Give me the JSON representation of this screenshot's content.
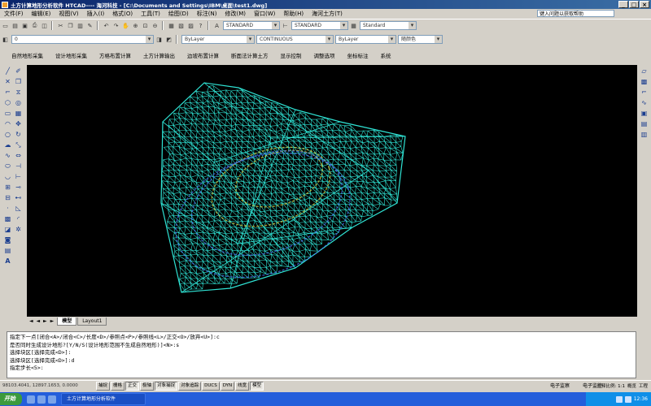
{
  "window": {
    "title": "土方计算地形分析软件 HTCAD---- 海河科技 - [C:\\Documents and Settings\\IBM\\桌面\\test1.dwg]"
  },
  "menu": [
    "文件(F)",
    "编辑(E)",
    "视图(V)",
    "插入(I)",
    "格式(O)",
    "工具(T)",
    "绘图(D)",
    "标注(N)",
    "修改(M)",
    "窗口(W)",
    "帮助(H)",
    "海河土方(T)"
  ],
  "help_search": {
    "placeholder": "键入问题以获取帮助"
  },
  "toolbar": {
    "text_style": "STANDARD",
    "dim_style": "STANDARD",
    "table_style": "Standard",
    "layer": "0",
    "color": "ByLayer",
    "linetype": "CONTINUOUS",
    "lineweight": "ByLayer",
    "plot_style": "随颜色"
  },
  "custom_menu": [
    "自然地形采集",
    "设计地形采集",
    "方格布置计算",
    "土方计算输出",
    "边坡布置计算",
    "断面法计算土方",
    "显示控制",
    "调整选项",
    "坐标标注",
    "系统"
  ],
  "layout_tabs": {
    "nav": "◄ ◄ ► ►",
    "tabs": [
      "模型",
      "Layout1"
    ],
    "active": 0
  },
  "command_lines": [
    "指定下一点[闭合<A>/闭合<C>/长度<D>/参照点<P>/参照线<L>/正交<O>/放弃<U>]:c",
    "是否同时生成设计地形?[Y/N/S(设计地形范围不生成自然地形)]<N>:s",
    "选择块区[选择完成<D>]:",
    "选择块区[选择完成<D>]:d",
    "指定步长<5>:"
  ],
  "status": {
    "coords": "98103.4041, 12897.1653, 0.0000",
    "toggles": [
      {
        "label": "捕捉",
        "on": false
      },
      {
        "label": "栅格",
        "on": false
      },
      {
        "label": "正交",
        "on": true
      },
      {
        "label": "极轴",
        "on": false
      },
      {
        "label": "对象捕捉",
        "on": true
      },
      {
        "label": "对象追踪",
        "on": false
      },
      {
        "label": "DUCS",
        "on": false
      },
      {
        "label": "DYN",
        "on": false
      },
      {
        "label": "线宽",
        "on": false
      },
      {
        "label": "模型",
        "on": true
      }
    ],
    "annotation_scale": "注释比例: 1:1",
    "right": [
      "概览",
      "工程"
    ]
  },
  "taskbar": {
    "start": "开始",
    "task": "土方计算地形分析软件",
    "tray": [
      "电子监察",
      "电子监控"
    ],
    "time": "12:36"
  },
  "colors": {
    "mesh": "#2fe3d4",
    "contour_yellow": "#d8d040",
    "contour_blue": "#4a6cf0",
    "canvas": "#000000"
  }
}
